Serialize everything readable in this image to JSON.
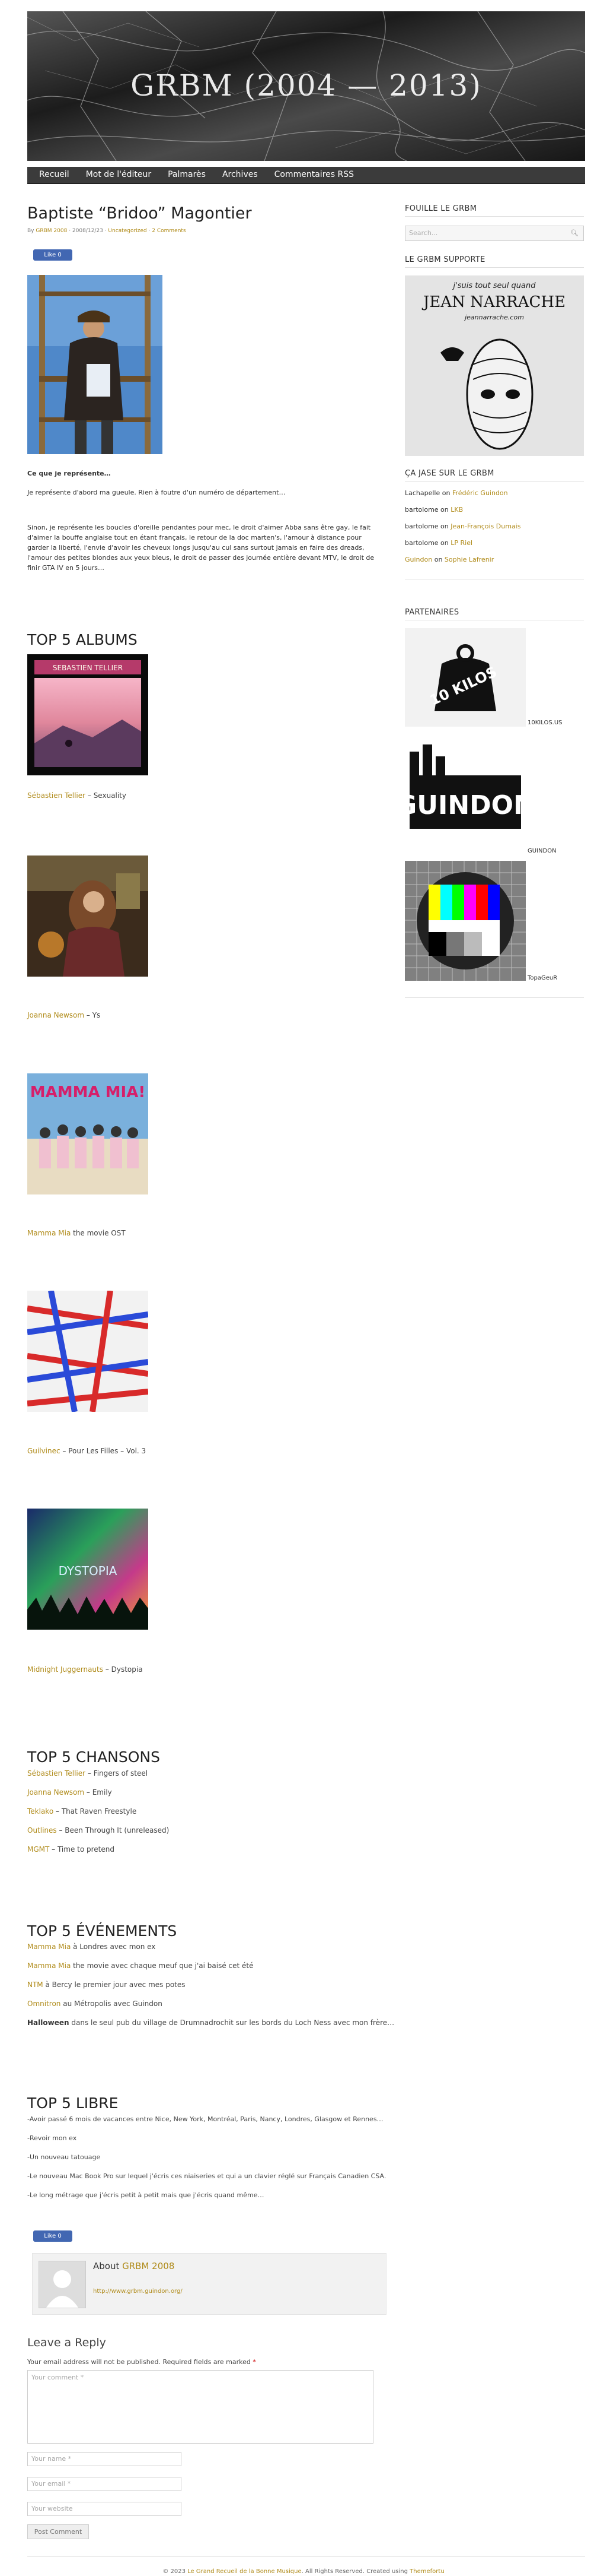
{
  "site": {
    "title": "GRBM (2004 — 2013)"
  },
  "nav": [
    "Recueil",
    "Mot de l'éditeur",
    "Palmarès",
    "Archives",
    "Commentaires RSS"
  ],
  "post": {
    "title": "Baptiste “Bridoo” Magontier",
    "meta_by": "By",
    "meta_author": "GRBM 2008",
    "meta_date": "· 2008/12/23 ·",
    "meta_category": "Uncategorized",
    "meta_sep": "·",
    "meta_comments": "2 Comments",
    "like": "Like 0",
    "q_bold": "Ce que je représente…",
    "q_line": "Je représente d'abord ma gueule. Rien à foutre d'un numéro de département…",
    "paragraph": "Sinon, je représente les boucles d'oreille pendantes pour mec, le droit d'aimer Abba sans être gay, le fait d'aimer la bouffe anglaise tout en étant français, le retour de la doc marten's, l'amour à distance pour garder la liberté, l'envie d'avoir les cheveux longs jusqu'au cul sans surtout jamais en faire des dreads, l'amour des petites blondes aux yeux bleus, le droit de passer des journée entière devant MTV, le droit de finir GTA IV en 5 jours…"
  },
  "albums": {
    "heading": "TOP 5 ALBUMS",
    "items": [
      {
        "artist": "Sébastien Tellier",
        "rest": " – Sexuality",
        "cover_text": "SEBASTIEN TELLIER"
      },
      {
        "artist": "Joanna Newsom",
        "rest": " – Ys",
        "cover_text": ""
      },
      {
        "artist": "Mamma Mia",
        "rest": " the movie OST",
        "cover_text": "MAMMA MIA!"
      },
      {
        "artist": "Guilvinec",
        "rest": " – Pour Les Filles – Vol. 3",
        "cover_text": ""
      },
      {
        "artist": "Midnight Juggernauts",
        "rest": " – Dystopia",
        "cover_text": "DYSTOPIA"
      }
    ]
  },
  "songs": {
    "heading": "TOP 5 CHANSONS",
    "items": [
      {
        "artist": "Sébastien Tellier",
        "rest": " – Fingers of steel"
      },
      {
        "artist": "Joanna Newsom",
        "rest": " – Emily"
      },
      {
        "artist": "Teklako",
        "rest": " – That Raven Freestyle"
      },
      {
        "artist": "Outlines",
        "rest": " – Been Through It (unreleased)"
      },
      {
        "artist": "MGMT",
        "rest": " – Time to pretend"
      }
    ]
  },
  "events": {
    "heading": "TOP 5 ÉVÉNEMENTS",
    "items": [
      {
        "artist": "Mamma Mia",
        "rest": " à Londres avec mon ex"
      },
      {
        "artist": "Mamma Mia",
        "rest": " the movie avec chaque meuf que j'ai baisé cet été"
      },
      {
        "artist": "NTM",
        "rest": " à Bercy le premier jour avec mes potes"
      },
      {
        "artist": "Omnitron",
        "rest": " au Métropolis avec Guindon"
      },
      {
        "artist": "Halloween",
        "rest": " dans le seul pub du village de Drumnadrochit sur les bords du Loch Ness avec mon frère…"
      }
    ]
  },
  "libre": {
    "heading": "TOP 5 LIBRE",
    "items": [
      "-Avoir passé 6 mois de vacances entre Nice, New York, Montréal, Paris, Nancy, Londres, Glasgow et Rennes…",
      "-Revoir mon ex",
      "-Un nouveau tatouage",
      "-Le nouveau Mac Book Pro sur lequel j'écris ces niaiseries et qui a un clavier réglé sur Français Canadien CSA.",
      "-Le long métrage que j'écris petit à petit mais que j'écris quand même…"
    ]
  },
  "about": {
    "label": "About",
    "name": "GRBM 2008",
    "url": "http://www.grbm.guindon.org/"
  },
  "reply": {
    "heading": "Leave a Reply",
    "note": "Your email address will not be published. Required fields are marked",
    "star": "*",
    "comment_ph": "Your comment *",
    "name_ph": "Your name *",
    "email_ph": "Your email *",
    "website_ph": "Your website",
    "submit": "Post Comment"
  },
  "sidebar": {
    "search_heading": "FOUILLE LE GRBM",
    "search_ph": "Search...",
    "supporte_heading": "LE GRBM SUPPORTE",
    "poster_line1": "j'suis tout seul quand",
    "poster_line2": "JEAN NARRACHE",
    "poster_url": "jeannarrache.com",
    "jase_heading": "ÇA JASE SUR LE GRBM",
    "jase": [
      {
        "who": "Lachapelle",
        "on": " on ",
        "what": "Frédéric Guindon",
        "who_link": false
      },
      {
        "who": "bartolome",
        "on": " on ",
        "what": "LKB",
        "who_link": false
      },
      {
        "who": "bartolome",
        "on": " on ",
        "what": "Jean-François Dumais",
        "who_link": false
      },
      {
        "who": "bartolome",
        "on": " on ",
        "what": "LP Riel",
        "who_link": false
      },
      {
        "who": "Guindon",
        "on": " on ",
        "what": "Sophie Lafrenir",
        "who_link": true
      }
    ],
    "partners_heading": "PARTENAIRES",
    "partners": [
      {
        "logo": "10 KILOS",
        "name": "10KILOS.US"
      },
      {
        "logo": "GUINDON",
        "name": "GUINDON"
      },
      {
        "logo": "",
        "name": "TopaGeuR"
      }
    ]
  },
  "footer": {
    "pre": "© 2023",
    "site": "Le Grand Recueil de la Bonne Musique",
    "mid": ". All Rights Reserved. Created using",
    "theme": "Themefortu"
  }
}
